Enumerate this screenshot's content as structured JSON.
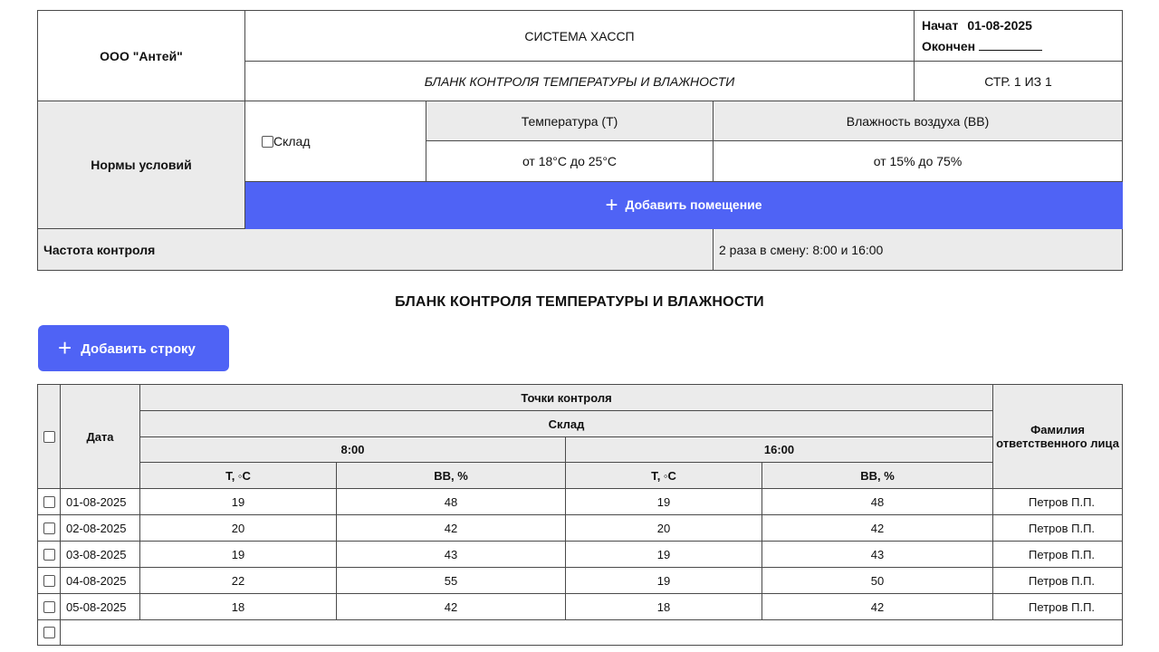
{
  "header": {
    "company": "ООО \"Антей\"",
    "system": "СИСТЕМА ХАССП",
    "started_label": "Начат",
    "started_value": "01-08-2025",
    "ended_label": "Окончен",
    "form_title": "БЛАНК КОНТРОЛЯ ТЕМПЕРАТУРЫ И ВЛАЖНОСТИ",
    "page": "СТР. 1 ИЗ 1"
  },
  "norms": {
    "label": "Нормы условий",
    "room_label": "Склад",
    "temp_header": "Температура (Т)",
    "humidity_header": "Влажность воздуха (ВВ)",
    "temp_range": "от 18°С до 25°С",
    "humidity_range": "от 15% до 75%",
    "add_room_label": "Добавить помещение"
  },
  "frequency": {
    "label": "Частота контроля",
    "value": "2 раза в смену: 8:00 и 16:00"
  },
  "section_title": "БЛАНК КОНТРОЛЯ ТЕМПЕРАТУРЫ И ВЛАЖНОСТИ",
  "add_row_label": "Добавить строку",
  "table": {
    "date_header": "Дата",
    "points_header": "Точки контроля",
    "room_header": "Склад",
    "time1": "8:00",
    "time2": "16:00",
    "t_header": "Т, ◦С",
    "h_header": "ВВ, %",
    "person_header": "Фамилия ответственного лица",
    "rows": [
      {
        "date": "01-08-2025",
        "t1": "19",
        "h1": "48",
        "t2": "19",
        "h2": "48",
        "person": "Петров П.П."
      },
      {
        "date": "02-08-2025",
        "t1": "20",
        "h1": "42",
        "t2": "20",
        "h2": "42",
        "person": "Петров П.П."
      },
      {
        "date": "03-08-2025",
        "t1": "19",
        "h1": "43",
        "t2": "19",
        "h2": "43",
        "person": "Петров П.П."
      },
      {
        "date": "04-08-2025",
        "t1": "22",
        "h1": "55",
        "t2": "19",
        "h2": "50",
        "person": "Петров П.П."
      },
      {
        "date": "05-08-2025",
        "t1": "18",
        "h1": "42",
        "t2": "18",
        "h2": "42",
        "person": "Петров П.П."
      }
    ]
  },
  "colors": {
    "accent": "#4f63f5",
    "header_gray": "#ebebeb"
  },
  "icons": {
    "add": "plus-icon",
    "checkbox": "checkbox-icon"
  }
}
